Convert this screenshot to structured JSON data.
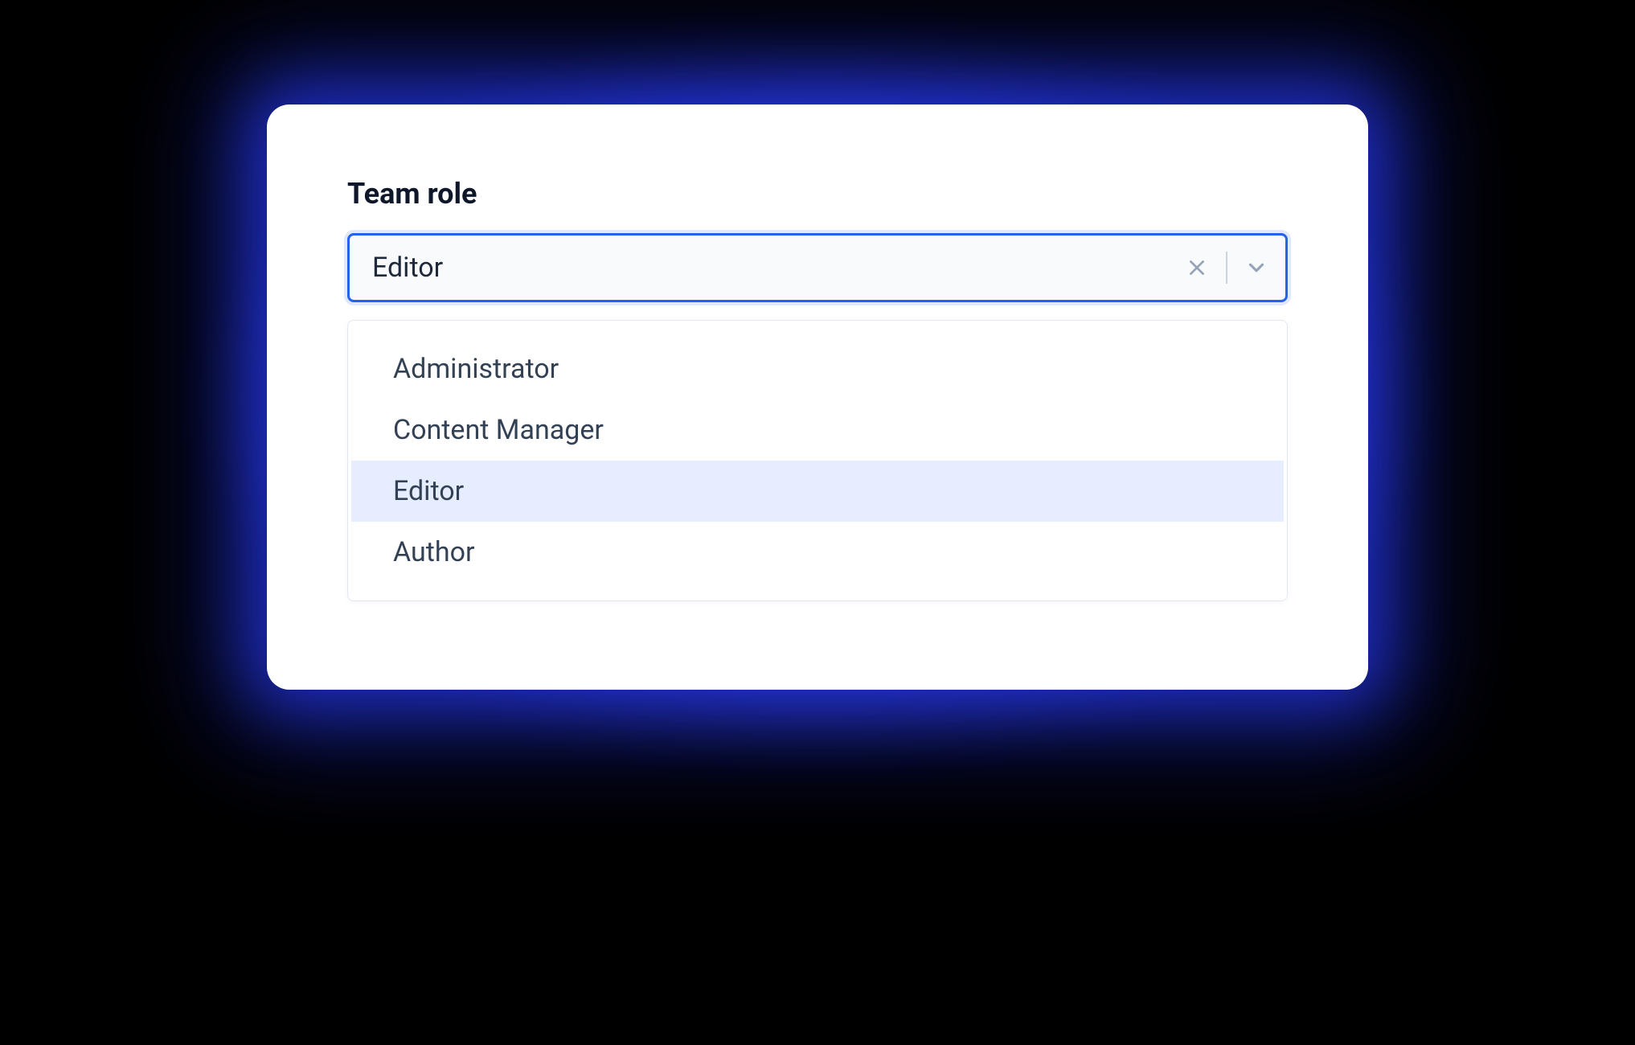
{
  "teamRole": {
    "label": "Team role",
    "selected": "Editor",
    "options": [
      {
        "label": "Administrator",
        "selected": false
      },
      {
        "label": "Content Manager",
        "selected": false
      },
      {
        "label": "Editor",
        "selected": true
      },
      {
        "label": "Author",
        "selected": false
      }
    ]
  }
}
